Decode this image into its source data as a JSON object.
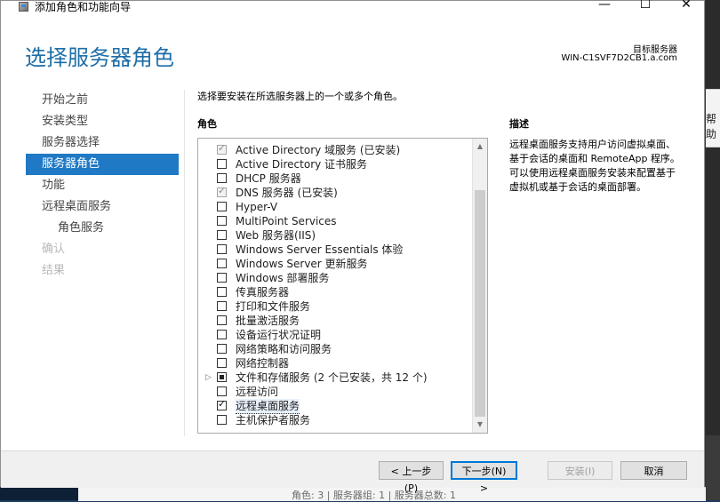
{
  "window": {
    "title": "添加角色和功能向导",
    "controls": {
      "minimize": "—",
      "maximize": "☐",
      "close": "✕"
    }
  },
  "header": {
    "page_title": "选择服务器角色",
    "target_label": "目标服务器",
    "target_value": "WIN-C1SVF7D2CB1.a.com"
  },
  "nav": {
    "items": [
      {
        "label": "开始之前",
        "state": "normal",
        "indent": 0
      },
      {
        "label": "安装类型",
        "state": "normal",
        "indent": 0
      },
      {
        "label": "服务器选择",
        "state": "normal",
        "indent": 0
      },
      {
        "label": "服务器角色",
        "state": "selected",
        "indent": 0
      },
      {
        "label": "功能",
        "state": "normal",
        "indent": 0
      },
      {
        "label": "远程桌面服务",
        "state": "normal",
        "indent": 0
      },
      {
        "label": "角色服务",
        "state": "normal",
        "indent": 1
      },
      {
        "label": "确认",
        "state": "disabled",
        "indent": 0
      },
      {
        "label": "结果",
        "state": "disabled",
        "indent": 0
      }
    ]
  },
  "main": {
    "instruction": "选择要安装在所选服务器上的一个或多个角色。",
    "roles_heading": "角色",
    "description_heading": "描述",
    "description_text": "远程桌面服务支持用户访问虚拟桌面、基于会话的桌面和 RemoteApp 程序。可以使用远程桌面服务安装来配置基于虚拟机或基于会话的桌面部署。",
    "roles": [
      {
        "label": "Active Directory 域服务 (已安装)",
        "state": "checked-disabled",
        "expandable": false
      },
      {
        "label": "Active Directory 证书服务",
        "state": "unchecked",
        "expandable": false
      },
      {
        "label": "DHCP 服务器",
        "state": "unchecked",
        "expandable": false
      },
      {
        "label": "DNS 服务器 (已安装)",
        "state": "checked-disabled",
        "expandable": false
      },
      {
        "label": "Hyper-V",
        "state": "unchecked",
        "expandable": false
      },
      {
        "label": "MultiPoint Services",
        "state": "unchecked",
        "expandable": false
      },
      {
        "label": "Web 服务器(IIS)",
        "state": "unchecked",
        "expandable": false
      },
      {
        "label": "Windows Server Essentials 体验",
        "state": "unchecked",
        "expandable": false
      },
      {
        "label": "Windows Server 更新服务",
        "state": "unchecked",
        "expandable": false
      },
      {
        "label": "Windows 部署服务",
        "state": "unchecked",
        "expandable": false
      },
      {
        "label": "传真服务器",
        "state": "unchecked",
        "expandable": false
      },
      {
        "label": "打印和文件服务",
        "state": "unchecked",
        "expandable": false
      },
      {
        "label": "批量激活服务",
        "state": "unchecked",
        "expandable": false
      },
      {
        "label": "设备运行状况证明",
        "state": "unchecked",
        "expandable": false
      },
      {
        "label": "网络策略和访问服务",
        "state": "unchecked",
        "expandable": false
      },
      {
        "label": "网络控制器",
        "state": "unchecked",
        "expandable": false
      },
      {
        "label": "文件和存储服务 (2 个已安装，共 12 个)",
        "state": "partial",
        "expandable": true
      },
      {
        "label": "远程访问",
        "state": "unchecked",
        "expandable": false
      },
      {
        "label": "远程桌面服务",
        "state": "checked",
        "expandable": false,
        "highlighted": true
      },
      {
        "label": "主机保护者服务",
        "state": "unchecked",
        "expandable": false
      }
    ]
  },
  "footer": {
    "prev_label": "< 上一步(P)",
    "next_label": "下一步(N) >",
    "install_label": "安装(I)",
    "cancel_label": "取消"
  },
  "background": {
    "status_text": "角色: 3 | 服务器组: 1 | 服务器总数: 1",
    "side_fragment": "帮助"
  },
  "icons": {
    "app": "server-manager-icon",
    "expander": "triangle-right-icon",
    "scroll_up": "scroll-up-arrow-icon",
    "scroll_down": "scroll-down-arrow-icon"
  },
  "colors": {
    "accent": "#1f79c4",
    "title_blue": "#1d6ea8",
    "focus_border": "#0078d7",
    "desktop": "#1f3a5f"
  }
}
